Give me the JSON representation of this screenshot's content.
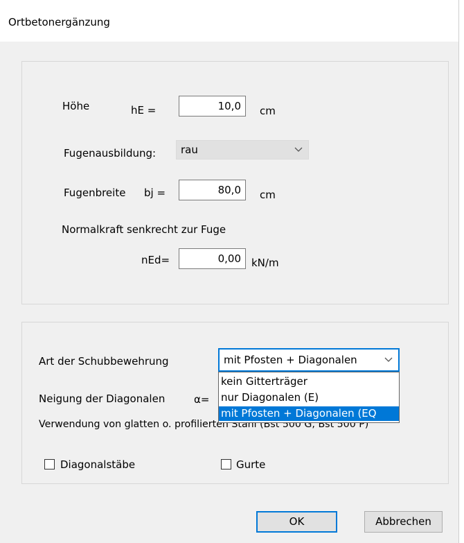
{
  "window": {
    "title": "Ortbetonergänzung"
  },
  "upper": {
    "hoehe_label": "Höhe",
    "he_label": "hE =",
    "he_value": "10,0",
    "he_unit": "cm",
    "fugen_label": "Fugenausbildung:",
    "fugen_value": "rau",
    "breite_label": "Fugenbreite",
    "bj_label": "bj  =",
    "bj_value": "80,0",
    "bj_unit": "cm",
    "normal_label": "Normalkraft senkrecht zur Fuge",
    "ned_label": "nEd=",
    "ned_value": "0,00",
    "ned_unit": "kN/m"
  },
  "lower": {
    "art_label": "Art der Schubbewehrung",
    "art_value": "mit Pfosten + Diagonalen",
    "options": [
      "kein Gitterträger",
      "nur Diagonalen (E)",
      "mit Pfosten + Diagonalen (EQ"
    ],
    "neigung_label": "Neigung der Diagonalen",
    "alpha_label": "α=",
    "verwendung_label": "Verwendung von glatten o. profilierten Stahl (Bst 500 G, Bst 500 P)",
    "diagonal_label": "Diagonalstäbe",
    "gurte_label": "Gurte"
  },
  "buttons": {
    "ok": "OK",
    "cancel": "Abbrechen"
  },
  "icons": {
    "dropdown": "chevron-down-icon"
  },
  "colors": {
    "accent": "#0078d7",
    "dialog_bg": "#f0f0f0"
  }
}
